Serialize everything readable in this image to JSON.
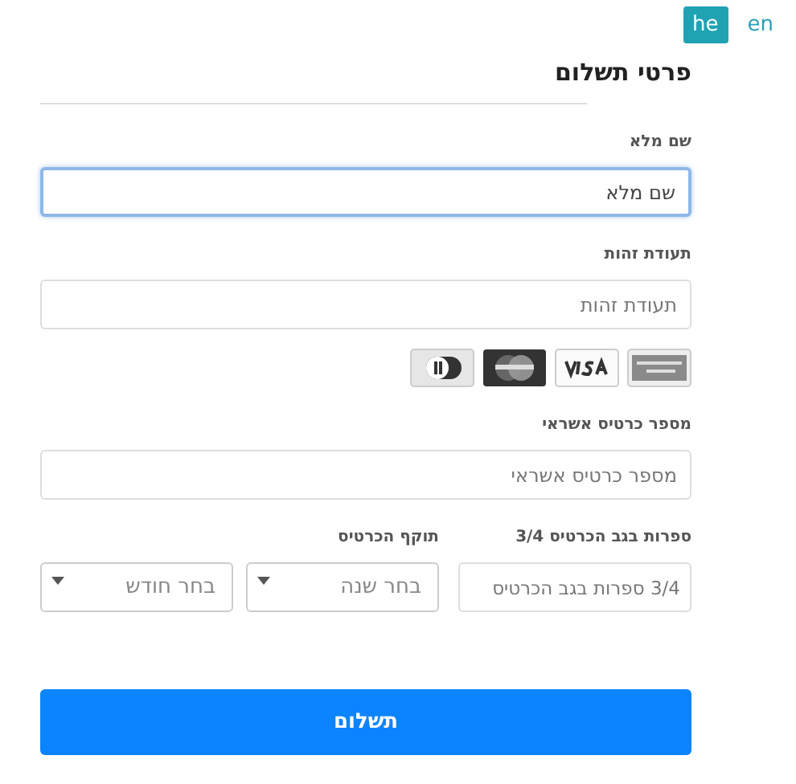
{
  "languages": [
    {
      "label": "en",
      "selected": false
    },
    {
      "label": "he",
      "selected": true
    }
  ],
  "title": "פרטי תשלום",
  "full_name": {
    "label": "שם מלא",
    "placeholder": "שם מלא",
    "focused": true
  },
  "id_number": {
    "label": "תעודת זהות",
    "placeholder": "תעודת זהות",
    "focused": false
  },
  "card_logos": [
    {
      "kind": "amex"
    },
    {
      "kind": "visa"
    },
    {
      "kind": "mastercard"
    },
    {
      "kind": "diners"
    }
  ],
  "card_number": {
    "label": "מספר כרטיס אשראי",
    "placeholder": "מספר כרטיס אשראי",
    "focused": false
  },
  "cvv": {
    "label": "ספרות בגב הכרטיס 3/4",
    "placeholder": "3/4 ספרות בגב הכרטיס"
  },
  "expiry": {
    "label": "תוקף הכרטיס",
    "year_placeholder": "בחר שנה",
    "month_placeholder": "בחר חודש"
  },
  "submit": "תשלום"
}
